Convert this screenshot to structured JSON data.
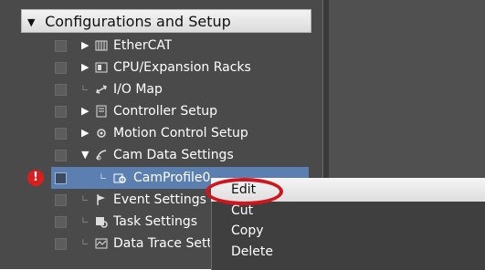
{
  "tree": {
    "header": {
      "expander": "▼",
      "label": "Configurations and Setup"
    },
    "items": [
      {
        "label": "EtherCAT",
        "expander": "▶",
        "icon": "ethercat-icon"
      },
      {
        "label": "CPU/Expansion Racks",
        "expander": "▶",
        "icon": "rack-icon"
      },
      {
        "label": "I/O Map",
        "expander": "",
        "icon": "io-map-icon"
      },
      {
        "label": "Controller Setup",
        "expander": "▶",
        "icon": "controller-icon"
      },
      {
        "label": "Motion Control Setup",
        "expander": "▶",
        "icon": "gear-icon"
      },
      {
        "label": "Cam Data Settings",
        "expander": "▼",
        "icon": "cam-icon"
      },
      {
        "label": "CamProfile0",
        "expander": "",
        "icon": "cam-profile-icon",
        "selected": true,
        "warning": "!"
      },
      {
        "label": "Event Settings",
        "expander": "",
        "icon": "flag-icon"
      },
      {
        "label": "Task Settings",
        "expander": "",
        "icon": "task-icon"
      },
      {
        "label": "Data Trace Setti",
        "expander": "",
        "icon": "trace-icon"
      }
    ]
  },
  "context_menu": {
    "items": [
      "Edit",
      "Cut",
      "Copy",
      "Delete"
    ]
  },
  "colors": {
    "selection": "#5b7fb0",
    "warning": "#d81e1e",
    "highlight_oval": "#d0151c"
  }
}
